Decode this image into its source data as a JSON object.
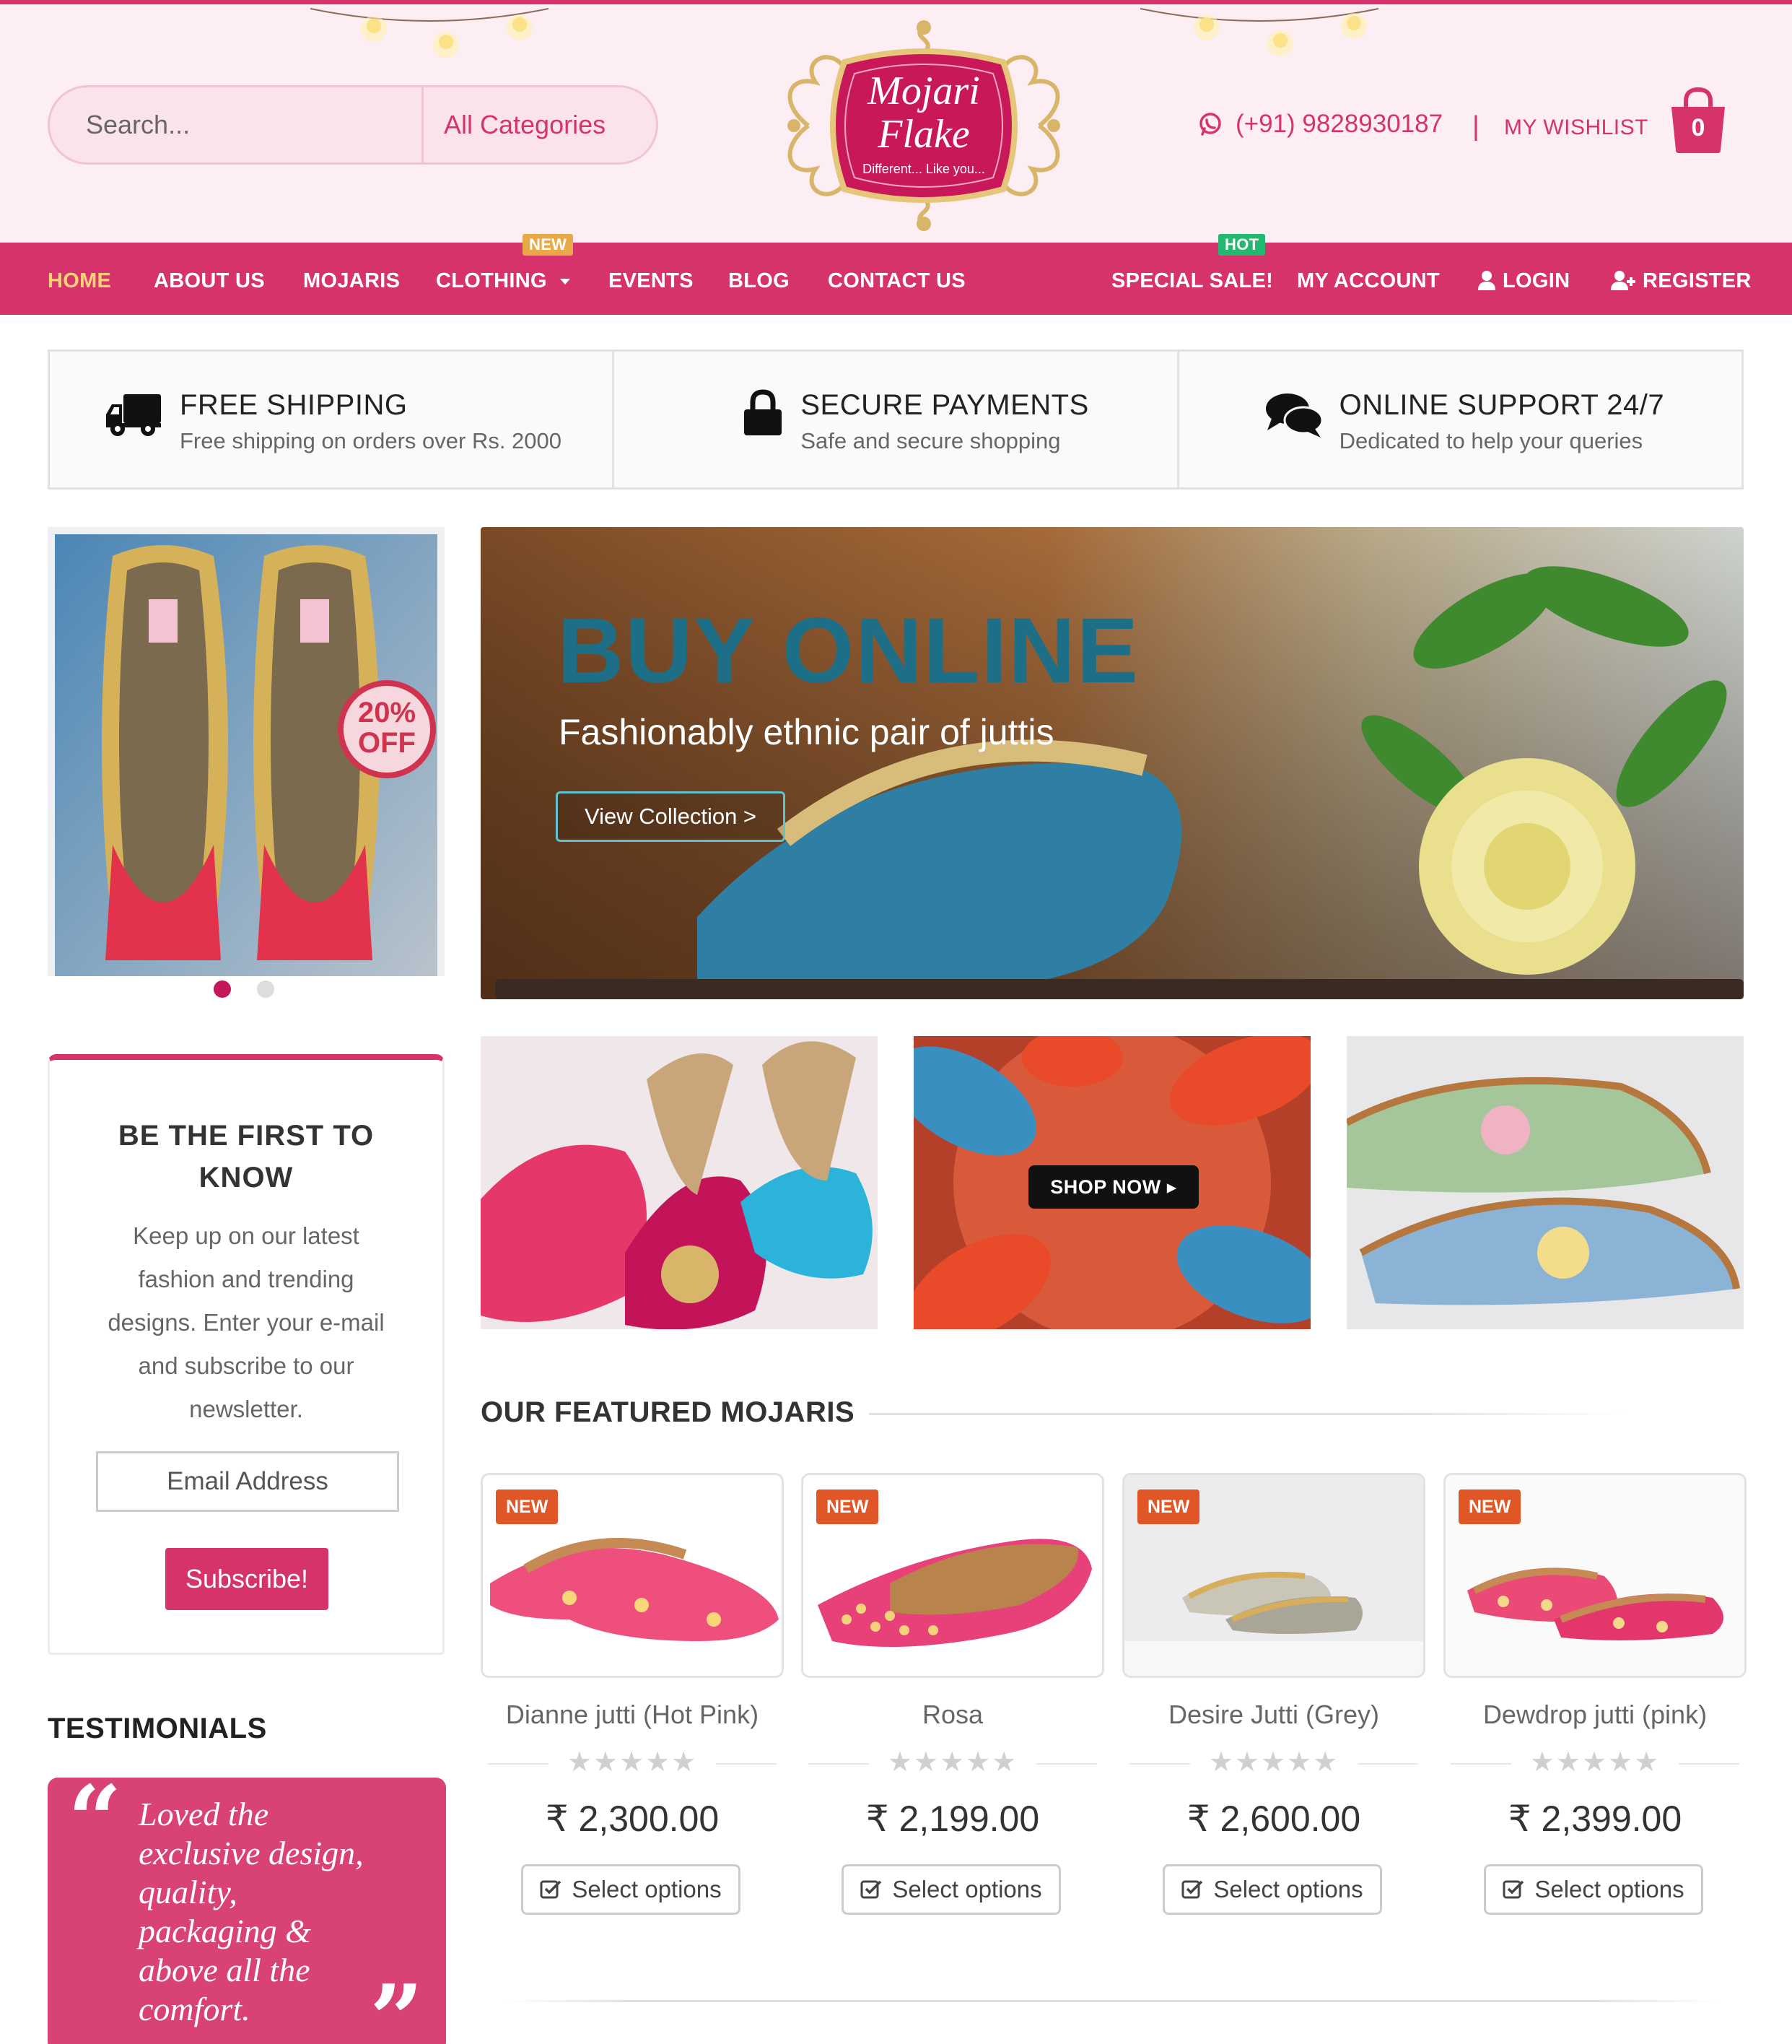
{
  "brand": {
    "logo_line1": "Mojari",
    "logo_line2": "Flake",
    "logo_tagline": "Different... Like you...",
    "accent_color": "#d6336c"
  },
  "header": {
    "search_placeholder": "Search...",
    "category_label": "All Categories",
    "phone": "(+91) 9828930187",
    "separator": "|",
    "wishlist_label": "MY WISHLIST",
    "cart_count": "0"
  },
  "nav": {
    "items": [
      {
        "label": "HOME",
        "active": true
      },
      {
        "label": "ABOUT US"
      },
      {
        "label": "MOJARIS"
      },
      {
        "label": "CLOTHING"
      },
      {
        "label": "EVENTS"
      },
      {
        "label": "BLOG"
      },
      {
        "label": "CONTACT US"
      }
    ],
    "right_items": [
      {
        "label": "SPECIAL SALE!"
      },
      {
        "label": "MY ACCOUNT"
      },
      {
        "label": "LOGIN"
      },
      {
        "label": "REGISTER"
      }
    ],
    "badges": {
      "clothing": "NEW",
      "special_sale": "HOT"
    }
  },
  "features": [
    {
      "title": "FREE SHIPPING",
      "subtitle": "Free shipping on orders over Rs. 2000",
      "icon": "truck-icon"
    },
    {
      "title": "SECURE PAYMENTS",
      "subtitle": "Safe and secure shopping",
      "icon": "lock-icon"
    },
    {
      "title": "ONLINE SUPPORT 24/7",
      "subtitle": "Dedicated to help your queries",
      "icon": "chat-icon"
    }
  ],
  "promo": {
    "stamp_line1": "20%",
    "stamp_line2": "OFF"
  },
  "hero": {
    "title": "BUY ONLINE",
    "subtitle": "Fashionably ethnic pair of juttis",
    "button_label": "View Collection >"
  },
  "tiles": {
    "shop_now_label": "SHOP NOW ▸"
  },
  "newsletter": {
    "title_line1": "BE THE FIRST TO",
    "title_line2": "KNOW",
    "text": "Keep up on our latest fashion and trending designs. Enter your e-mail and subscribe to our newsletter.",
    "email_placeholder": "Email Address",
    "button_label": "Subscribe!"
  },
  "testimonials": {
    "title": "TESTIMONIALS",
    "quote": "Loved the exclusive design, quality, packaging & above all the comfort."
  },
  "featured": {
    "title": "OUR FEATURED MOJARIS",
    "products": [
      {
        "badge": "NEW",
        "name": "Dianne jutti (Hot Pink)",
        "price": "₹ 2,300.00",
        "rating": 0,
        "button": "Select options"
      },
      {
        "badge": "NEW",
        "name": "Rosa",
        "price": "₹ 2,199.00",
        "rating": 0,
        "button": "Select options"
      },
      {
        "badge": "NEW",
        "name": "Desire Jutti (Grey)",
        "price": "₹ 2,600.00",
        "rating": 0,
        "button": "Select options"
      },
      {
        "badge": "NEW",
        "name": "Dewdrop jutti (pink)",
        "price": "₹ 2,399.00",
        "rating": 0,
        "button": "Select options"
      }
    ],
    "stars": "★★★★★"
  }
}
